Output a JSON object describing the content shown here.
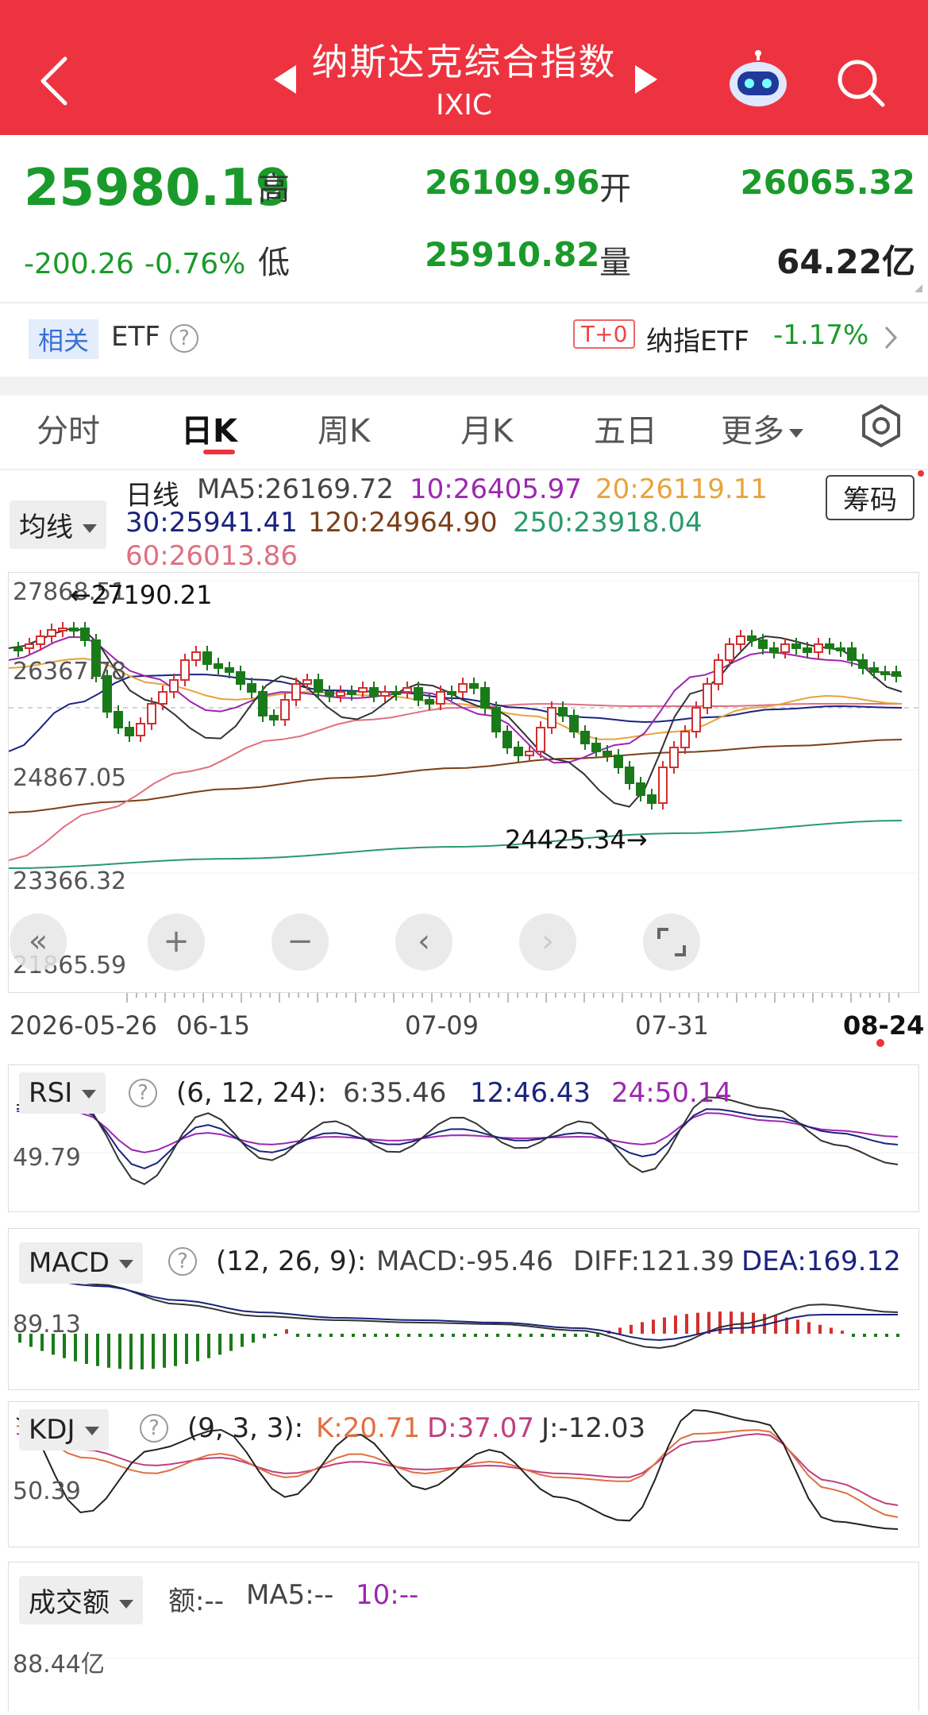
{
  "header": {
    "title": "纳斯达克综合指数",
    "code": "IXIC",
    "bg_color": "#ee3340"
  },
  "quote": {
    "price": "25980.19",
    "change": "-200.26",
    "change_pct": "-0.76%",
    "high_label": "高",
    "high": "26109.96",
    "low_label": "低",
    "low": "25910.82",
    "open_label": "开",
    "open": "26065.32",
    "volume_label": "量",
    "volume": "64.22亿"
  },
  "etf": {
    "tag": "相关",
    "label": "ETF",
    "badge": "T+0",
    "name": "纳指ETF",
    "change": "-1.17%"
  },
  "tabs": [
    "分时",
    "日K",
    "周K",
    "月K",
    "五日",
    "更多"
  ],
  "active_tab": "日K",
  "ma_legend": {
    "selector": "均线",
    "daily": "日线",
    "ma5": "MA5:26169.72",
    "ma10": "10:26405.97",
    "ma20": "20:26119.11",
    "ma30": "30:25941.41",
    "ma120": "120:24964.90",
    "ma250": "250:23918.04",
    "ma60": "60:26013.86",
    "chip_button": "筹码"
  },
  "kchart": {
    "y_labels": [
      "27868.51",
      "26367.78",
      "24867.05",
      "23366.32",
      "21865.59"
    ],
    "high_mark": "←27190.21",
    "low_mark": "24425.34→",
    "dates": [
      "2026-05-26",
      "06-15",
      "07-09",
      "07-31",
      "08-24"
    ],
    "colors": {
      "up": "#d32f2f",
      "down": "#1a7a1a",
      "ma5": "#333333",
      "ma10": "#9c27b0",
      "ma20": "#e8a33c",
      "ma30": "#1a237e",
      "ma60": "#e07080",
      "ma120": "#7b3f1a",
      "ma250": "#2a9a6a"
    }
  },
  "rsi": {
    "label": "RSI",
    "params": "(6, 12, 24):",
    "v6": "6:35.46",
    "v12": "12:46.43",
    "v24": "24:50.14",
    "axis": "49.79"
  },
  "macd": {
    "label": "MACD",
    "params": "(12, 26, 9):",
    "macd": "MACD:-95.46",
    "diff": "DIFF:121.39",
    "dea": "DEA:169.12",
    "axis": "89.13"
  },
  "kdj": {
    "label": "KDJ",
    "params": "(9, 3, 3):",
    "k": "K:20.71",
    "d": "D:37.07",
    "j": "J:-12.03",
    "axis": "50.39"
  },
  "amount": {
    "label": "成交额",
    "amt": "额:--",
    "ma5": "MA5:--",
    "ma10": "10:--",
    "axis": "88.44亿"
  }
}
